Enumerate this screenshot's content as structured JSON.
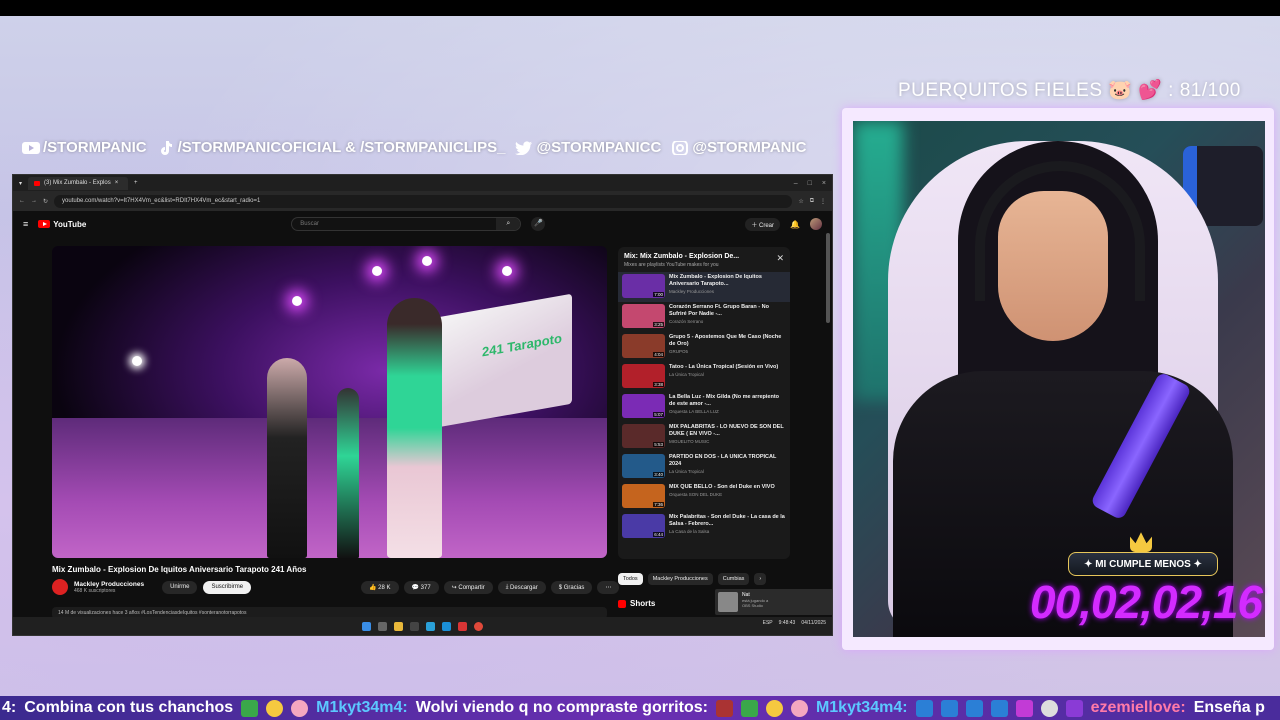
{
  "overlay": {
    "counter_text": "PUERQUITOS FIELES 🐷 💕 : 81/100",
    "socials": [
      {
        "icon": "youtube-icon",
        "label": "/STORMPANIC"
      },
      {
        "icon": "tiktok-icon",
        "label": "/STORMPANICOFICIAL & /STORMPANICLIPS_"
      },
      {
        "icon": "twitter-icon",
        "label": "@STORMPANICC"
      },
      {
        "icon": "instagram-icon",
        "label": "@STORMPANIC"
      }
    ],
    "birthday_label": "✦ MI CUMPLE MENOS ✦",
    "timer": "00,02,02,16"
  },
  "browser": {
    "tab_title": "(3) Mix Zumbalo - Explos",
    "url": "youtube.com/watch?v=It7HX4Vm_ec&list=RDIt7HX4Vm_ec&start_radio=1",
    "search_placeholder": "Buscar",
    "create_label": "Crear",
    "notification_count": "3"
  },
  "video": {
    "title": "Mix Zumbalo - Explosion De Iquitos Aniversario Tarapoto 241 Años",
    "channel": "Mackley Producciones",
    "subscribers": "468 K suscriptores",
    "join_label": "Unirme",
    "subscribe_label": "Suscribirme",
    "likes": "28 K",
    "comments": "377",
    "share_label": "Compartir",
    "download_label": "Descargar",
    "thanks_label": "Gracias",
    "banner_text": "241 Tarapoto",
    "description_line": "14 M de visualizaciones  hace 3 años  #LosTendenciasdeIquitos #sonteranotorrapotos"
  },
  "mix": {
    "title": "Mix: Mix Zumbalo - Explosion De...",
    "subtitle": "Mixes are playlists YouTube makes for you",
    "items": [
      {
        "title": "Mix Zumbalo - Explosion De Iquitos Aniversario Tarapoto...",
        "channel": "Mackley Producciones",
        "duration": "7:00",
        "color": "#6a2ea6"
      },
      {
        "title": "Corazón Serrano Ft. Grupo Baran - No Sufriré Por Nadie -...",
        "channel": "Corazón Serrano",
        "duration": "3:25",
        "color": "#c4486f"
      },
      {
        "title": "Grupo 5 - Apostemos Que Me Caso (Noche de Oro)",
        "channel": "GRUPO5",
        "duration": "4:04",
        "color": "#8a3b2a"
      },
      {
        "title": "Tatoo - La Única Tropical (Sesión en Vivo)",
        "channel": "La Única Tropical",
        "duration": "3:38",
        "color": "#b2202a"
      },
      {
        "title": "La Bella Luz - Mix Gilda (No me arrepiento de este amor -...",
        "channel": "Orquesta LA BELLA LUZ",
        "duration": "5:07",
        "color": "#7b2bb5"
      },
      {
        "title": "MIX PALABRITAS - LO NUEVO DE SON DEL DUKE ( EN VIVO -...",
        "channel": "MIGUELITO MUSIC",
        "duration": "5:53",
        "color": "#5a2a2a"
      },
      {
        "title": "PARTIDO EN DOS - LA UNICA TROPICAL 2024",
        "channel": "La Única Tropical",
        "duration": "3:40",
        "color": "#235a8a"
      },
      {
        "title": "MIX QUE BELLO - Son del Duke en VIVO",
        "channel": "Orquesta SON DEL DUKE",
        "duration": "7:36",
        "color": "#c5641e"
      },
      {
        "title": "Mix Palabritas - Son del Duke - La casa de la Salsa - Febrero...",
        "channel": "La Casa de la Salsa",
        "duration": "6:44",
        "color": "#4a3aa6"
      }
    ],
    "chips": [
      "Todos",
      "Mackley Producciones",
      "Cumbias"
    ],
    "shorts_label": "Shorts"
  },
  "notification": {
    "name": "Nat",
    "line1": "está jugando a",
    "line2": "OBS Studio"
  },
  "tray": {
    "lang": "ESP",
    "time": "9:48:43",
    "date": "04/11/2025"
  },
  "ticker": [
    {
      "user": "4:",
      "msg": "Combina con tus chanchos",
      "ucls": "w"
    },
    {
      "user": "M1kyt34m4:",
      "msg": "Wolvi viendo q no compraste gorritos:",
      "ucls": "u"
    },
    {
      "user": "M1kyt34m4:",
      "msg": "",
      "ucls": "u"
    },
    {
      "user": "ezemiellove:",
      "msg": "Enseña p",
      "ucls": "u2"
    }
  ],
  "colors": {
    "accent": "#d32bff",
    "youtube_red": "#ff0000",
    "ticker_bg": "#5a2fa8"
  }
}
